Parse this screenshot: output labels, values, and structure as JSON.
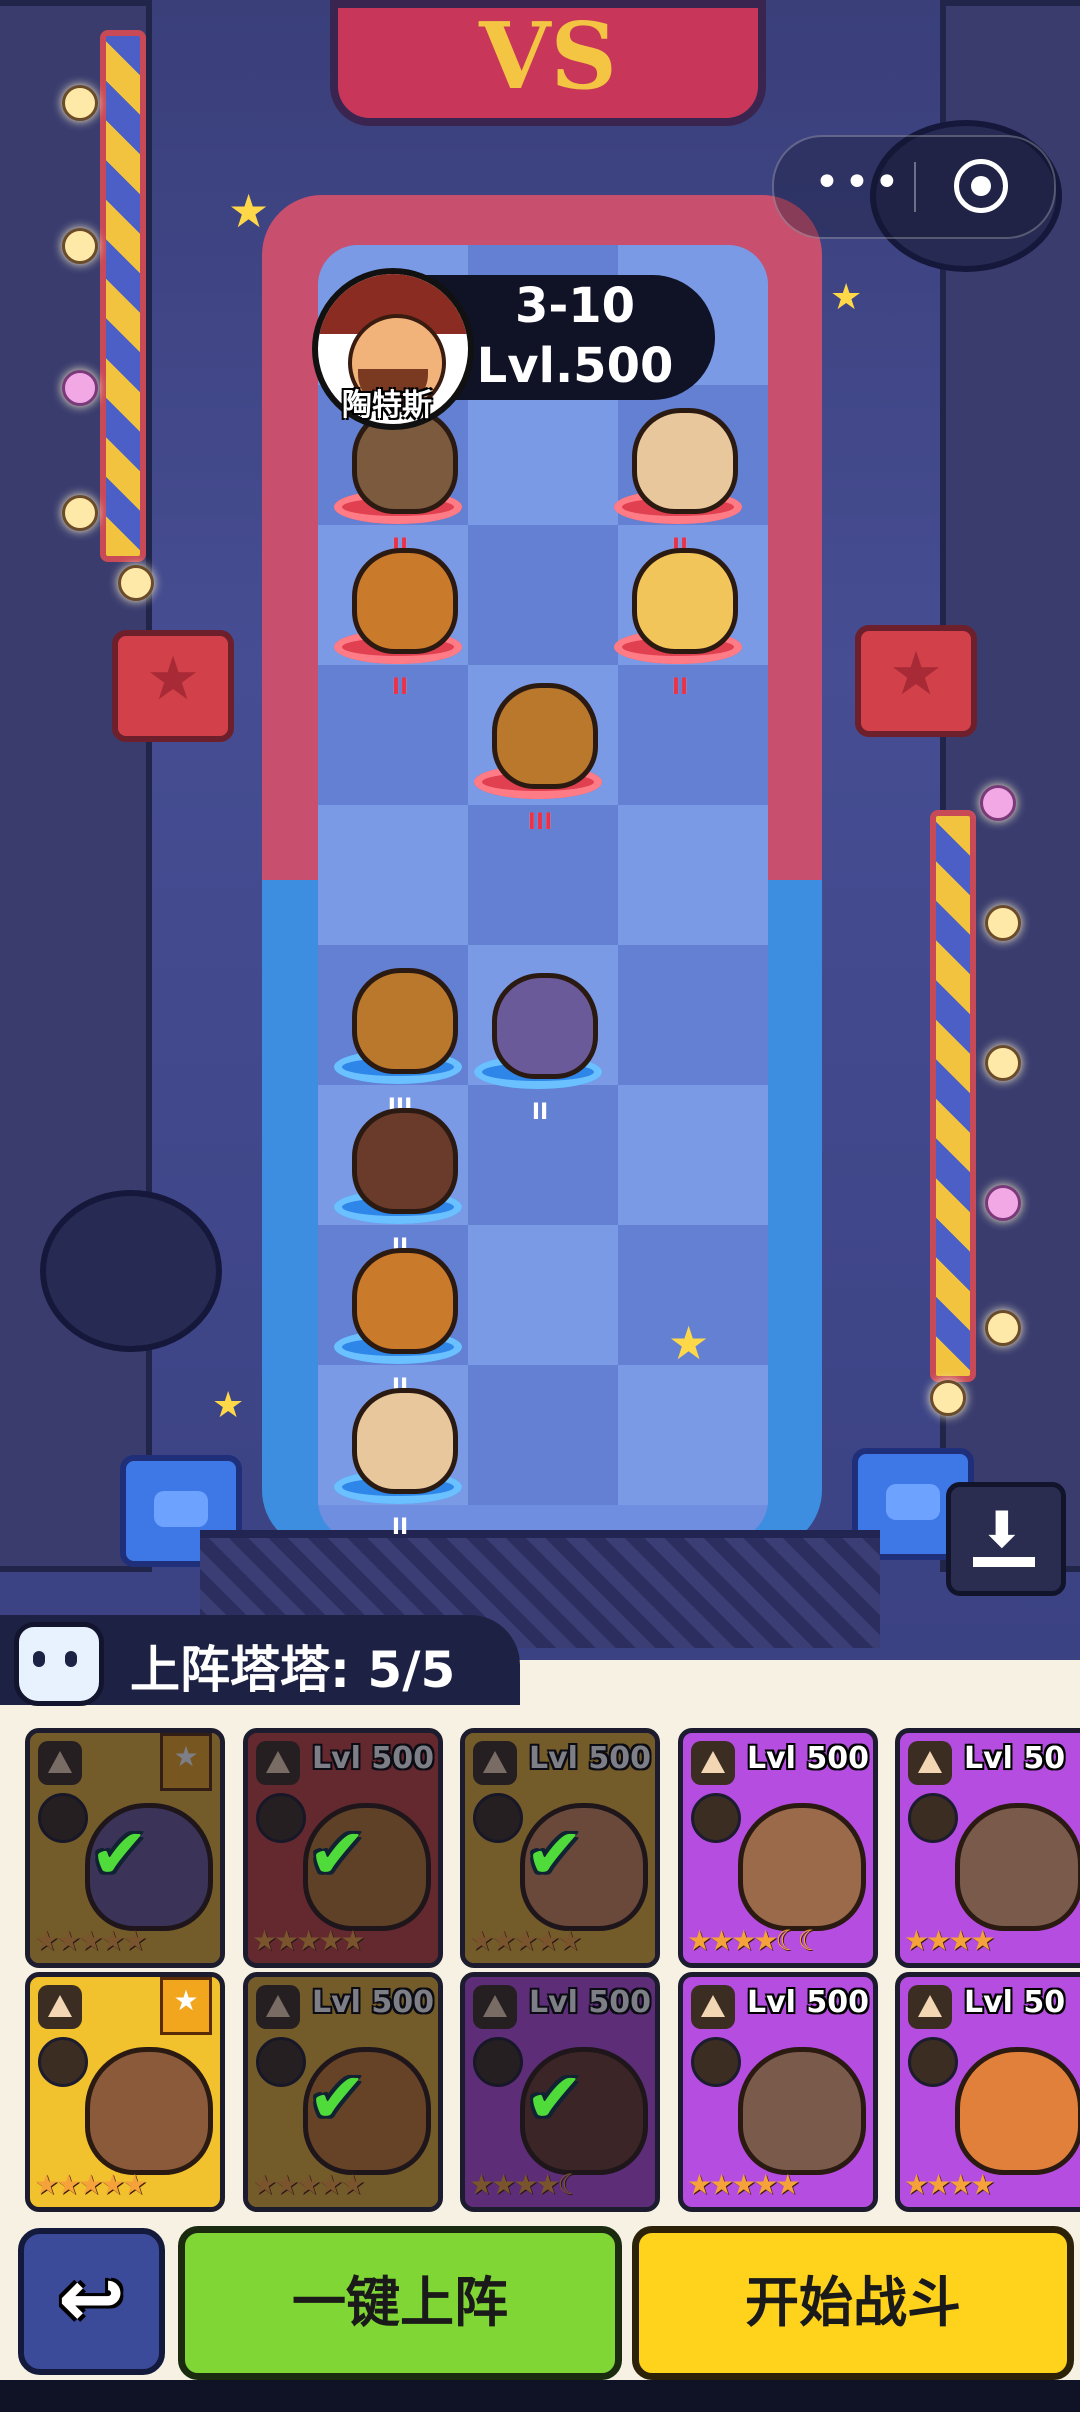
{
  "opponent": {
    "stage": "3-10",
    "level": "Lvl.500",
    "name": "陶特斯"
  },
  "board_sign": "VS",
  "lineup": {
    "label": "上阵塔塔: 5/5"
  },
  "rank_marks": {
    "enemy": [
      "II",
      "II",
      "II",
      "II",
      "III"
    ],
    "ally": [
      "III",
      "II",
      "II",
      "II",
      "II"
    ]
  },
  "cards_row1": [
    {
      "level": "",
      "selected": true,
      "stars": "★★★★★",
      "color": "#e9b233",
      "pet_color": "#6a5a9a"
    },
    {
      "level": "Lvl 500",
      "selected": true,
      "stars": "★★★★★",
      "color": "#c5413e",
      "pet_color": "#b9782c"
    },
    {
      "level": "Lvl 500",
      "selected": true,
      "stars": "★★★★★",
      "color": "#e9b233",
      "pet_color": "#d28a5a"
    },
    {
      "level": "Lvl 500",
      "selected": false,
      "stars": "★★★★☾☾",
      "color": "#b54de0",
      "pet_color": "#9a6a4a"
    },
    {
      "level": "Lvl 50",
      "selected": false,
      "stars": "★★★★",
      "color": "#b54de0",
      "pet_color": "#7a5a4a"
    }
  ],
  "cards_row2": [
    {
      "level": "",
      "selected": false,
      "stars": "★★★★★",
      "color": "#f1c22e",
      "pet_color": "#8a5a3a"
    },
    {
      "level": "Lvl 500",
      "selected": true,
      "stars": "★★★★★",
      "color": "#e9b233",
      "pet_color": "#c97a2a"
    },
    {
      "level": "Lvl 500",
      "selected": true,
      "stars": "★★★★☾",
      "color": "#b54de0",
      "pet_color": "#6a3a2a"
    },
    {
      "level": "Lvl 500",
      "selected": false,
      "stars": "★★★★★",
      "color": "#b54de0",
      "pet_color": "#7a5a4a"
    },
    {
      "level": "Lvl 50",
      "selected": false,
      "stars": "★★★★",
      "color": "#b54de0",
      "pet_color": "#e0803a"
    }
  ],
  "buttons": {
    "back_icon": "return-arrow-icon",
    "auto_deploy": "一键上阵",
    "start_battle": "开始战斗"
  },
  "colors": {
    "enemy_ring": "#e0404f",
    "ally_ring": "#2e86e8",
    "auto_btn": "#7fd634",
    "start_btn": "#ffd21c"
  }
}
